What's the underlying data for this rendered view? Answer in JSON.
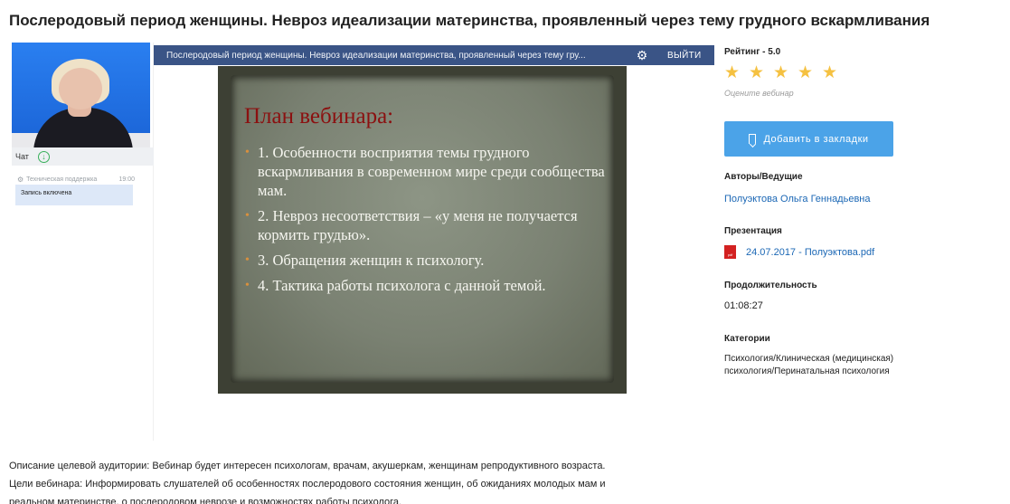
{
  "page": {
    "title": "Послеродовый период женщины. Невроз идеализации материнства, проявленный через тему грудного вскармливания"
  },
  "left_panel": {
    "chat_label": "Чат",
    "chat_download_icon": "download-circle-icon",
    "message": {
      "author": "Техническая поддержка",
      "time": "19:00",
      "text": "Запись включена"
    }
  },
  "player": {
    "title": "Послеродовый период женщины. Невроз идеализации материнства, проявленный через тему гру...",
    "exit_label": "ВЫЙТИ",
    "settings_icon": "gear-icon",
    "slide": {
      "title": "План вебинара:",
      "items": [
        "1. Особенности восприятия темы грудного вскармливания в современном мире среди сообщества мам.",
        "2. Невроз несоответствия – «у меня не получается кормить грудью».",
        "3. Обращения женщин к психологу.",
        "4. Тактика работы психолога с данной темой."
      ]
    }
  },
  "sidebar": {
    "rating_label": "Рейтинг - 5.0",
    "stars": 5,
    "rate_hint": "Оцените вебинар",
    "bookmark_label": "Добавить в закладки",
    "authors_label": "Авторы/Ведущие",
    "author_name": "Полуэктова Ольга Геннадьевна",
    "presentation_label": "Презентация",
    "presentation_file": "24.07.2017 - Полуэктова.pdf",
    "pdf_icon_text": "pdf",
    "duration_label": "Продолжительность",
    "duration": "01:08:27",
    "categories_label": "Категории",
    "categories": "Психология/Клиническая (медицинская) психология/Перинатальная психология"
  },
  "description": {
    "line1": "Описание целевой аудитории: Вебинар будет интересен психологам, врачам, акушеркам, женщинам репродуктивного возраста.",
    "line2": "Цели вебинара: Информировать слушателей об особенностях послеродового состояния женщин, об ожиданиях молодых мам и",
    "line3": "реальном материнстве, о послеродовом неврозе и возможностях работы психолога."
  },
  "colors": {
    "player_bar": "#3a5486",
    "accent_button": "#4ba3e8",
    "link": "#1b67b5",
    "star": "#f5c141",
    "slide_title": "#8b1010",
    "slide_bullet": "#d9903d"
  }
}
